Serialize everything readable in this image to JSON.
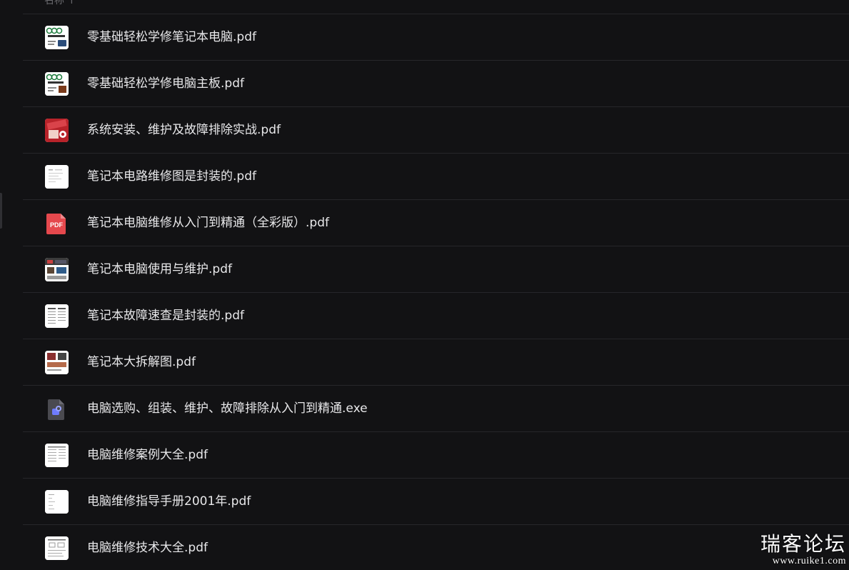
{
  "header": {
    "label": "名称 ↑"
  },
  "files": [
    {
      "name": "零基础轻松学修笔记本电脑.pdf",
      "thumb": "book-cover-icon"
    },
    {
      "name": "零基础轻松学修电脑主板.pdf",
      "thumb": "book-cover-icon"
    },
    {
      "name": "系统安装、维护及故障排除实战.pdf",
      "thumb": "red-book-cover-icon"
    },
    {
      "name": "笔记本电路维修图是封装的.pdf",
      "thumb": "document-page-icon"
    },
    {
      "name": "笔记本电脑维修从入门到精通（全彩版）.pdf",
      "thumb": "pdf-file-icon"
    },
    {
      "name": "笔记本电脑使用与维护.pdf",
      "thumb": "photo-page-icon"
    },
    {
      "name": "笔记本故障速查是封装的.pdf",
      "thumb": "document-page-icon"
    },
    {
      "name": "笔记本大拆解图.pdf",
      "thumb": "photo-page-icon"
    },
    {
      "name": "电脑选购、组装、维护、故障排除从入门到精通.exe",
      "thumb": "exe-file-icon"
    },
    {
      "name": "电脑维修案例大全.pdf",
      "thumb": "document-page-icon"
    },
    {
      "name": "电脑维修指导手册2001年.pdf",
      "thumb": "document-page-icon"
    },
    {
      "name": "电脑维修技术大全.pdf",
      "thumb": "document-page-icon"
    }
  ],
  "watermark": {
    "title": "瑞客论坛",
    "url": "www.ruike1.com"
  },
  "colors": {
    "background": "#121214",
    "divider": "#26262a",
    "text": "#e8e8ea",
    "pdf_red": "#e5484d",
    "exe_gray": "#4a4a50",
    "exe_accent": "#6f7cff"
  }
}
